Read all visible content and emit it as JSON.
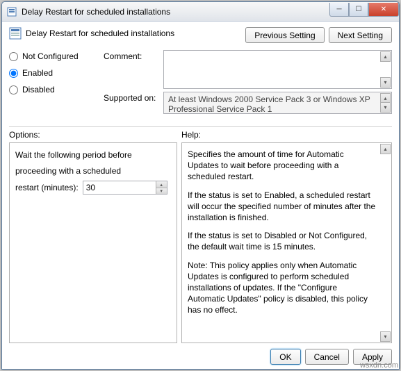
{
  "window": {
    "title": "Delay Restart for scheduled installations"
  },
  "header": {
    "policy_title": "Delay Restart for scheduled installations",
    "prev_btn": "Previous Setting",
    "next_btn": "Next Setting"
  },
  "state": {
    "not_configured": "Not Configured",
    "enabled": "Enabled",
    "disabled": "Disabled",
    "selected": "enabled"
  },
  "fields": {
    "comment_label": "Comment:",
    "comment_value": "",
    "supported_label": "Supported on:",
    "supported_value": "At least Windows 2000 Service Pack 3 or Windows XP Professional Service Pack 1"
  },
  "sections": {
    "options_label": "Options:",
    "help_label": "Help:"
  },
  "options": {
    "line1": "Wait the following period before",
    "line2": "proceeding with a scheduled",
    "restart_label": "restart (minutes):",
    "restart_value": "30"
  },
  "help": {
    "p1": "Specifies the amount of time for Automatic Updates to wait before proceeding with a scheduled restart.",
    "p2": "If the status is set to Enabled, a scheduled restart will occur the specified number of minutes after the installation is finished.",
    "p3": "If the status is set to Disabled or Not Configured, the default wait time is 15 minutes.",
    "p4": "Note: This policy applies only when Automatic Updates is configured to perform scheduled installations of updates. If the \"Configure Automatic Updates\" policy is disabled, this policy has no effect."
  },
  "footer": {
    "ok": "OK",
    "cancel": "Cancel",
    "apply": "Apply"
  },
  "watermark": "wsxdn.com"
}
